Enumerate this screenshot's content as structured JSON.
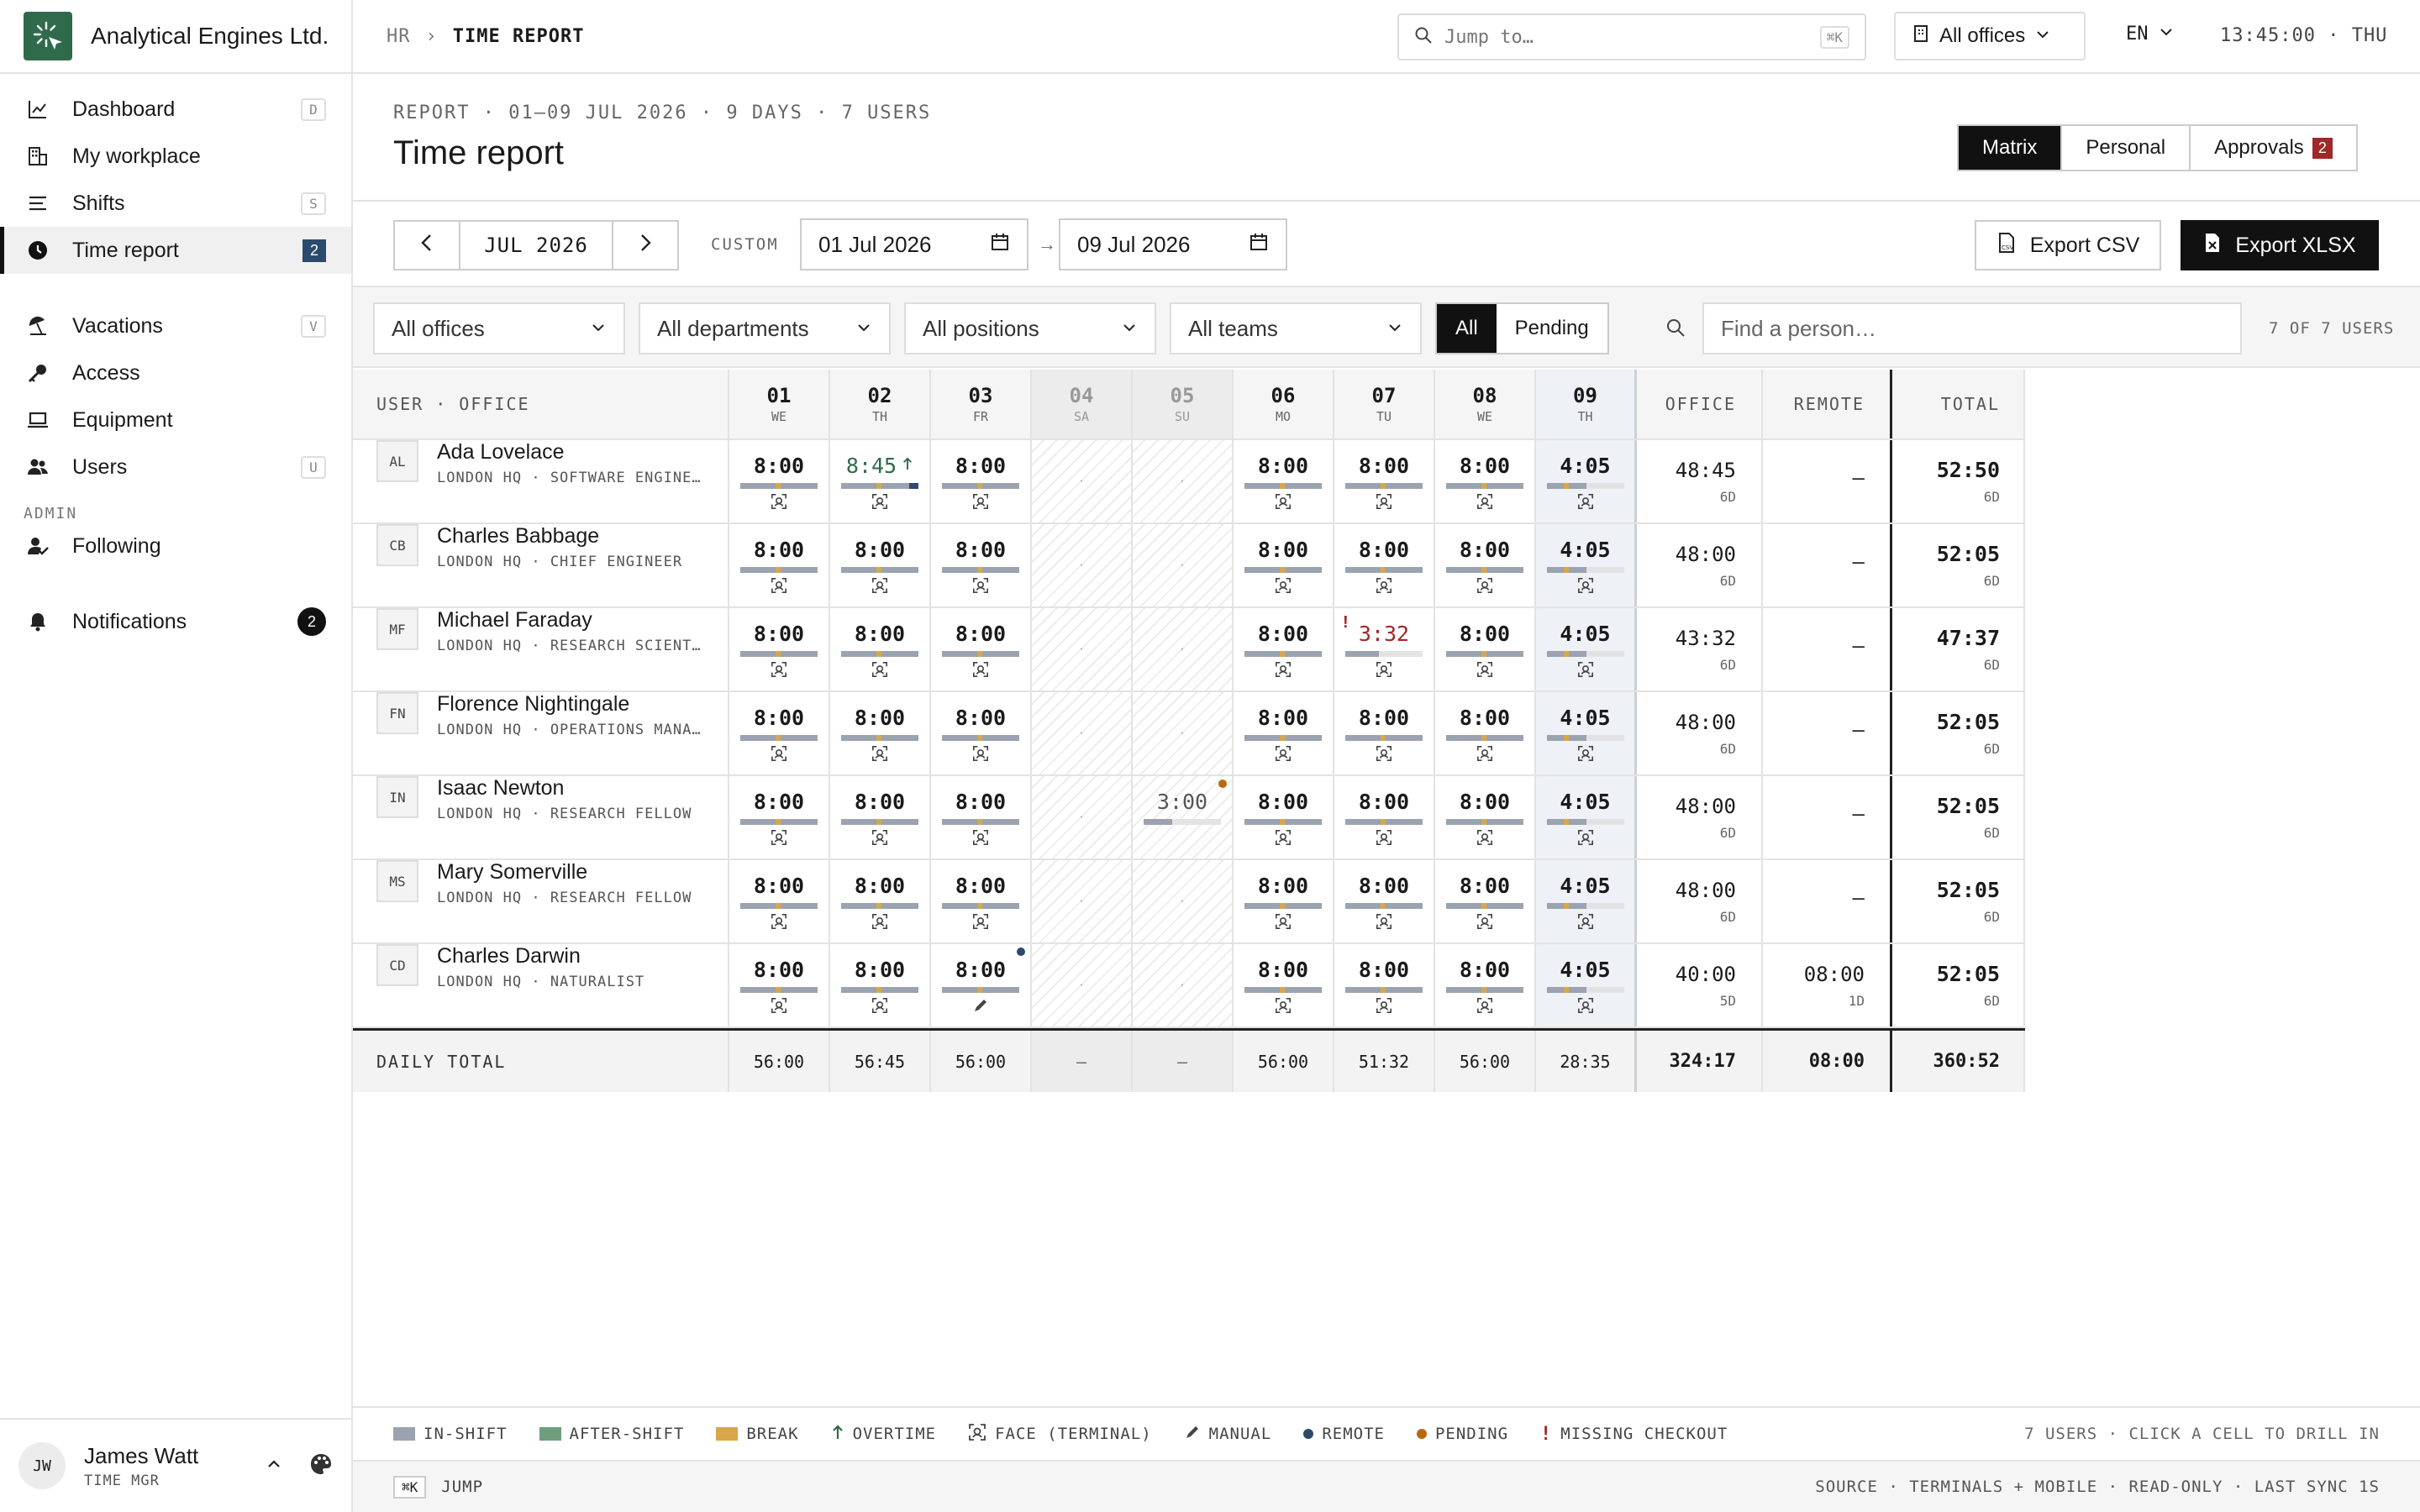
{
  "brand": {
    "name": "Analytical Engines Ltd.",
    "logo_icon": "sparkle-cursor-icon",
    "logo_color": "#2f6b4b"
  },
  "sidebar": {
    "items": [
      {
        "label": "Dashboard",
        "icon": "chart-line-icon",
        "key": "D"
      },
      {
        "label": "My workplace",
        "icon": "building-icon",
        "key": ""
      },
      {
        "label": "Shifts",
        "icon": "list-icon",
        "key": "S"
      },
      {
        "label": "Time report",
        "icon": "clock-icon",
        "badge": "2"
      },
      {
        "label": "Vacations",
        "icon": "beach-umbrella-icon",
        "key": "V"
      },
      {
        "label": "Access",
        "icon": "key-icon",
        "key": ""
      },
      {
        "label": "Equipment",
        "icon": "laptop-icon",
        "key": ""
      },
      {
        "label": "Users",
        "icon": "users-icon",
        "key": "U"
      }
    ],
    "admin_section": "ADMIN",
    "admin_items": [
      {
        "label": "Following",
        "icon": "user-check-icon"
      }
    ],
    "notifications": {
      "label": "Notifications",
      "icon": "bell-icon",
      "badge": "2"
    },
    "user": {
      "initials": "JW",
      "name": "James Watt",
      "role": "TIME MGR"
    }
  },
  "topbar": {
    "crumb_parent": "HR",
    "crumb_sep": "›",
    "crumb_current": "TIME REPORT",
    "search_placeholder": "Jump to…",
    "search_key": "⌘K",
    "office": "All offices",
    "lang": "EN",
    "clock": "13:45:00 · THU"
  },
  "header": {
    "meta": "REPORT · 01–09 JUL 2026 · 9 DAYS · 7 USERS",
    "title": "Time report",
    "views": [
      {
        "label": "Matrix"
      },
      {
        "label": "Personal"
      },
      {
        "label": "Approvals",
        "badge": "2"
      }
    ]
  },
  "controls": {
    "month": "JUL 2026",
    "custom_label": "CUSTOM",
    "date_from": "01 Jul 2026",
    "date_arrow": "→",
    "date_to": "09 Jul 2026",
    "export_csv": "Export CSV",
    "export_xlsx": "Export XLSX"
  },
  "filters": {
    "offices": "All offices",
    "departments": "All departments",
    "positions": "All positions",
    "teams": "All teams",
    "status_all": "All",
    "status_pending": "Pending",
    "person_placeholder": "Find a person…",
    "count": "7 OF 7 USERS"
  },
  "table": {
    "col_user": "USER · OFFICE",
    "col_office": "OFFICE",
    "col_remote": "REMOTE",
    "col_total": "TOTAL",
    "days": [
      {
        "n": "01",
        "w": "WE"
      },
      {
        "n": "02",
        "w": "TH"
      },
      {
        "n": "03",
        "w": "FR"
      },
      {
        "n": "04",
        "w": "SA"
      },
      {
        "n": "05",
        "w": "SU"
      },
      {
        "n": "06",
        "w": "MO"
      },
      {
        "n": "07",
        "w": "TU"
      },
      {
        "n": "08",
        "w": "WE"
      },
      {
        "n": "09",
        "w": "TH"
      }
    ],
    "users": [
      {
        "initials": "AL",
        "name": "Ada Lovelace",
        "sub": "LONDON HQ · SOFTWARE ENGINEER",
        "cells": [
          "8:00",
          "8:45",
          "8:00",
          "·",
          "·",
          "8:00",
          "8:00",
          "8:00",
          "4:05"
        ],
        "office": "48:45",
        "office_days": "6D",
        "remote": "—",
        "remote_days": "",
        "total": "52:50",
        "total_days": "6D"
      },
      {
        "initials": "CB",
        "name": "Charles Babbage",
        "sub": "LONDON HQ · CHIEF ENGINEER",
        "cells": [
          "8:00",
          "8:00",
          "8:00",
          "·",
          "·",
          "8:00",
          "8:00",
          "8:00",
          "4:05"
        ],
        "office": "48:00",
        "office_days": "6D",
        "remote": "—",
        "remote_days": "",
        "total": "52:05",
        "total_days": "6D"
      },
      {
        "initials": "MF",
        "name": "Michael Faraday",
        "sub": "LONDON HQ · RESEARCH SCIENTIST",
        "cells": [
          "8:00",
          "8:00",
          "8:00",
          "·",
          "·",
          "8:00",
          "3:32",
          "8:00",
          "4:05"
        ],
        "office": "43:32",
        "office_days": "6D",
        "remote": "—",
        "remote_days": "",
        "total": "47:37",
        "total_days": "6D"
      },
      {
        "initials": "FN",
        "name": "Florence Nightingale",
        "sub": "LONDON HQ · OPERATIONS MANAGER",
        "cells": [
          "8:00",
          "8:00",
          "8:00",
          "·",
          "·",
          "8:00",
          "8:00",
          "8:00",
          "4:05"
        ],
        "office": "48:00",
        "office_days": "6D",
        "remote": "—",
        "remote_days": "",
        "total": "52:05",
        "total_days": "6D"
      },
      {
        "initials": "IN",
        "name": "Isaac Newton",
        "sub": "LONDON HQ · RESEARCH FELLOW",
        "cells": [
          "8:00",
          "8:00",
          "8:00",
          "·",
          "3:00",
          "8:00",
          "8:00",
          "8:00",
          "4:05"
        ],
        "office": "48:00",
        "office_days": "6D",
        "remote": "—",
        "remote_days": "",
        "total": "52:05",
        "total_days": "6D"
      },
      {
        "initials": "MS",
        "name": "Mary Somerville",
        "sub": "LONDON HQ · RESEARCH FELLOW",
        "cells": [
          "8:00",
          "8:00",
          "8:00",
          "·",
          "·",
          "8:00",
          "8:00",
          "8:00",
          "4:05"
        ],
        "office": "48:00",
        "office_days": "6D",
        "remote": "—",
        "remote_days": "",
        "total": "52:05",
        "total_days": "6D"
      },
      {
        "initials": "CD",
        "name": "Charles Darwin",
        "sub": "LONDON HQ · NATURALIST",
        "cells": [
          "8:00",
          "8:00",
          "8:00",
          "·",
          "·",
          "8:00",
          "8:00",
          "8:00",
          "4:05"
        ],
        "office": "40:00",
        "office_days": "5D",
        "remote": "08:00",
        "remote_days": "1D",
        "total": "52:05",
        "total_days": "6D"
      }
    ],
    "footer": {
      "label": "DAILY TOTAL",
      "days": [
        "56:00",
        "56:45",
        "56:00",
        "—",
        "—",
        "56:00",
        "51:32",
        "56:00",
        "28:35"
      ],
      "office": "324:17",
      "remote": "08:00",
      "total": "360:52"
    }
  },
  "legend": {
    "items": [
      {
        "label": "IN-SHIFT",
        "color": "#9aa3af"
      },
      {
        "label": "AFTER-SHIFT",
        "color": "#6f9e7e"
      },
      {
        "label": "BREAK",
        "color": "#d8a74a"
      },
      {
        "label": "OVERTIME",
        "icon": "arrow-up-icon"
      },
      {
        "label": "FACE (TERMINAL)",
        "icon": "face-scan-icon"
      },
      {
        "label": "MANUAL",
        "icon": "pencil-icon"
      },
      {
        "label": "REMOTE",
        "color": "#2c4a6e"
      },
      {
        "label": "PENDING",
        "color": "#b8690e"
      },
      {
        "label": "MISSING CHECKOUT",
        "icon": "exclamation-icon"
      }
    ],
    "note": "7 USERS · CLICK A CELL TO DRILL IN"
  },
  "statusbar": {
    "key": "⌘K",
    "label": "JUMP",
    "right": "SOURCE · TERMINALS + MOBILE · READ-ONLY · LAST SYNC 1S"
  }
}
